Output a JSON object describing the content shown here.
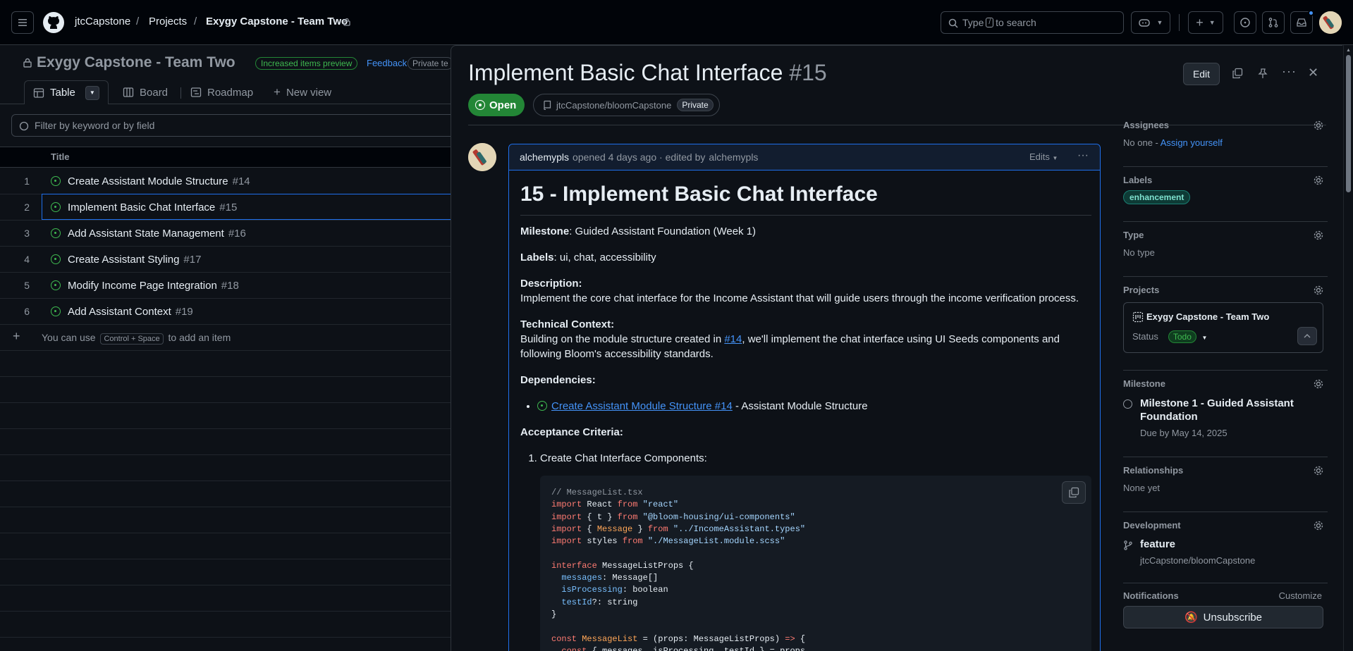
{
  "header": {
    "org": "jtcCapstone",
    "projects": "Projects",
    "project_name": "Exygy Capstone - Team Two",
    "search_placeholder_pre": "Type",
    "search_key": "/",
    "search_placeholder_post": "to search"
  },
  "project": {
    "title": "Exygy Capstone - Team Two",
    "preview_pill": "Increased items preview",
    "feedback": "Feedback",
    "private_pill": "Private te",
    "tabs": [
      "Table",
      "Board",
      "Roadmap",
      "New view"
    ],
    "filter_placeholder": "Filter by keyword or by field",
    "column_title": "Title",
    "rows": [
      {
        "num": "1",
        "title": "Create Assistant Module Structure",
        "ref": "#14"
      },
      {
        "num": "2",
        "title": "Implement Basic Chat Interface",
        "ref": "#15"
      },
      {
        "num": "3",
        "title": "Add Assistant State Management",
        "ref": "#16"
      },
      {
        "num": "4",
        "title": "Create Assistant Styling",
        "ref": "#17"
      },
      {
        "num": "5",
        "title": "Modify Income Page Integration",
        "ref": "#18"
      },
      {
        "num": "6",
        "title": "Add Assistant Context",
        "ref": "#19"
      }
    ],
    "add_item_pre": "You can use",
    "add_item_key": "Control + Space",
    "add_item_post": "to add an item"
  },
  "issue": {
    "title": "Implement Basic Chat Interface",
    "number": "#15",
    "state": "Open",
    "repo": "jtcCapstone/bloomCapstone",
    "visibility": "Private",
    "edit_label": "Edit",
    "author": "alchemypls",
    "opened": "opened 4 days ago · edited by",
    "editor": "alchemypls",
    "edits": "Edits",
    "body": {
      "heading": "15 - Implement Basic Chat Interface",
      "milestone_label": "Milestone",
      "milestone_value": ": Guided Assistant Foundation (Week 1)",
      "labels_label": "Labels",
      "labels_value": ": ui, chat, accessibility",
      "description_label": "Description",
      "description_text": "Implement the core chat interface for the Income Assistant that will guide users through the income verification process.",
      "tech_label": "Technical Context",
      "tech_pre": "Building on the module structure created in ",
      "tech_link": "#14",
      "tech_post": ", we'll implement the chat interface using UI Seeds components and following Bloom's accessibility standards.",
      "deps_label": "Dependencies",
      "dep_link": "Create Assistant Module Structure #14",
      "dep_post": " - Assistant Module Structure",
      "acceptance_label": "Acceptance Criteria",
      "criteria_1": "Create Chat Interface Components:",
      "code_lines": [
        "// MessageList.tsx",
        "import React from \"react\"",
        "import { t } from \"@bloom-housing/ui-components\"",
        "import { Message } from \"../IncomeAssistant.types\"",
        "import styles from \"./MessageList.module.scss\"",
        "",
        "interface MessageListProps {",
        "  messages: Message[]",
        "  isProcessing: boolean",
        "  testId?: string",
        "}",
        "",
        "const MessageList = (props: MessageListProps) => {",
        "  const { messages, isProcessing, testId } = props"
      ]
    }
  },
  "sidebar": {
    "assignees_title": "Assignees",
    "assignees_value": "No one - ",
    "assign_yourself": "Assign yourself",
    "labels_title": "Labels",
    "label": "enhancement",
    "type_title": "Type",
    "type_value": "No type",
    "projects_title": "Projects",
    "project_card_name": "Exygy Capstone - Team Two",
    "status_label": "Status",
    "status_value": "Todo",
    "milestone_title": "Milestone",
    "milestone_name": "Milestone 1 - Guided Assistant Foundation",
    "milestone_due": "Due by May 14, 2025",
    "relationships_title": "Relationships",
    "relationships_value": "None yet",
    "development_title": "Development",
    "branch": "feature",
    "branch_repo": "jtcCapstone/bloomCapstone",
    "notifications_title": "Notifications",
    "customize": "Customize",
    "unsubscribe": "Unsubscribe"
  },
  "colors": {
    "background": "#0d1117",
    "accent": "#1f6feb",
    "open_green": "#238636",
    "link": "#4493f8"
  }
}
